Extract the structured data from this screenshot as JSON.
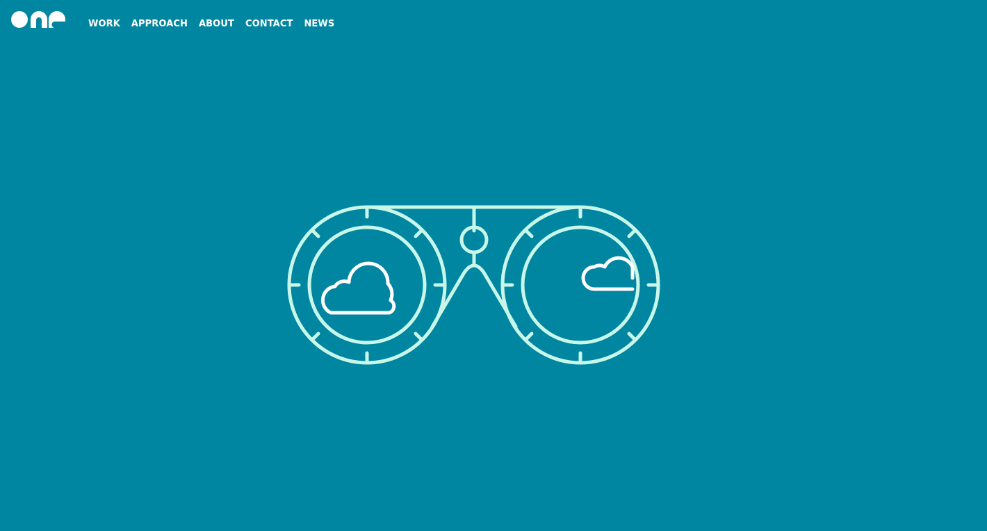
{
  "header": {
    "logo_name": "one-logo",
    "nav": [
      {
        "label": "WORK"
      },
      {
        "label": "APPROACH"
      },
      {
        "label": "ABOUT"
      },
      {
        "label": "CONTACT"
      },
      {
        "label": "NEWS"
      }
    ]
  },
  "hero": {
    "illustration": "binoculars-with-clouds-icon"
  },
  "colors": {
    "background": "#0086a1",
    "nav_text": "#ffffff",
    "illustration_stroke": "#c8f7ea",
    "cloud_stroke": "#ffffff"
  }
}
